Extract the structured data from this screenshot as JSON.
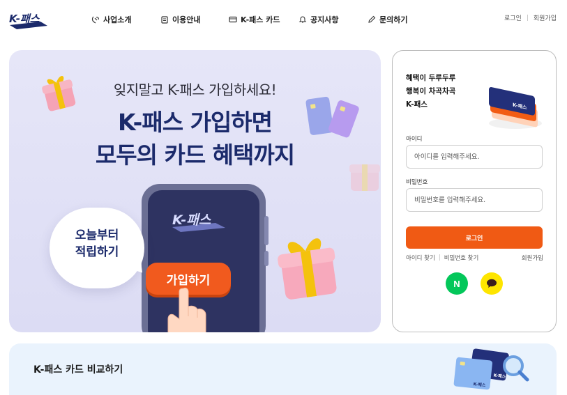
{
  "brand": {
    "logo_text": "K-패스",
    "color": "#1b2a6b"
  },
  "nav": {
    "items": [
      {
        "label": "사업소개",
        "icon": "handshake-icon"
      },
      {
        "label": "이용안내",
        "icon": "clipboard-icon"
      },
      {
        "label": "K-패스 카드",
        "icon": "card-icon"
      },
      {
        "label": "공지사항",
        "icon": "bell-icon"
      },
      {
        "label": "문의하기",
        "icon": "pencil-icon"
      }
    ]
  },
  "util": {
    "login": "로그인",
    "signup": "회원가입"
  },
  "hero": {
    "subtitle": "잊지말고 K-패스 가입하세요!",
    "title_line1": "K-패스 가입하면",
    "title_line2": "모두의 카드 혜택까지",
    "bubble_line1": "오늘부터",
    "bubble_line2": "적립하기",
    "join_button": "가입하기",
    "phone_logo": "K-패스",
    "card_logo": "K-패스"
  },
  "login": {
    "tagline_1": "혜택이 두루두루",
    "tagline_2": "행복이 차곡차곡",
    "tagline_3": "K-패스",
    "card_logo": "K-패스",
    "id_label": "아이디",
    "id_placeholder": "아이디를 입력해주세요.",
    "pw_label": "비밀번호",
    "pw_placeholder": "비밀번호를 입력해주세요.",
    "login_button": "로그인",
    "find_id": "아이디 찾기",
    "find_pw": "비밀번호 찾기",
    "signup": "회원가입",
    "naver_letter": "N",
    "accent": "#f05a14"
  },
  "compare": {
    "title": "K-패스 카드 비교하기",
    "card_logo": "K-패스"
  }
}
